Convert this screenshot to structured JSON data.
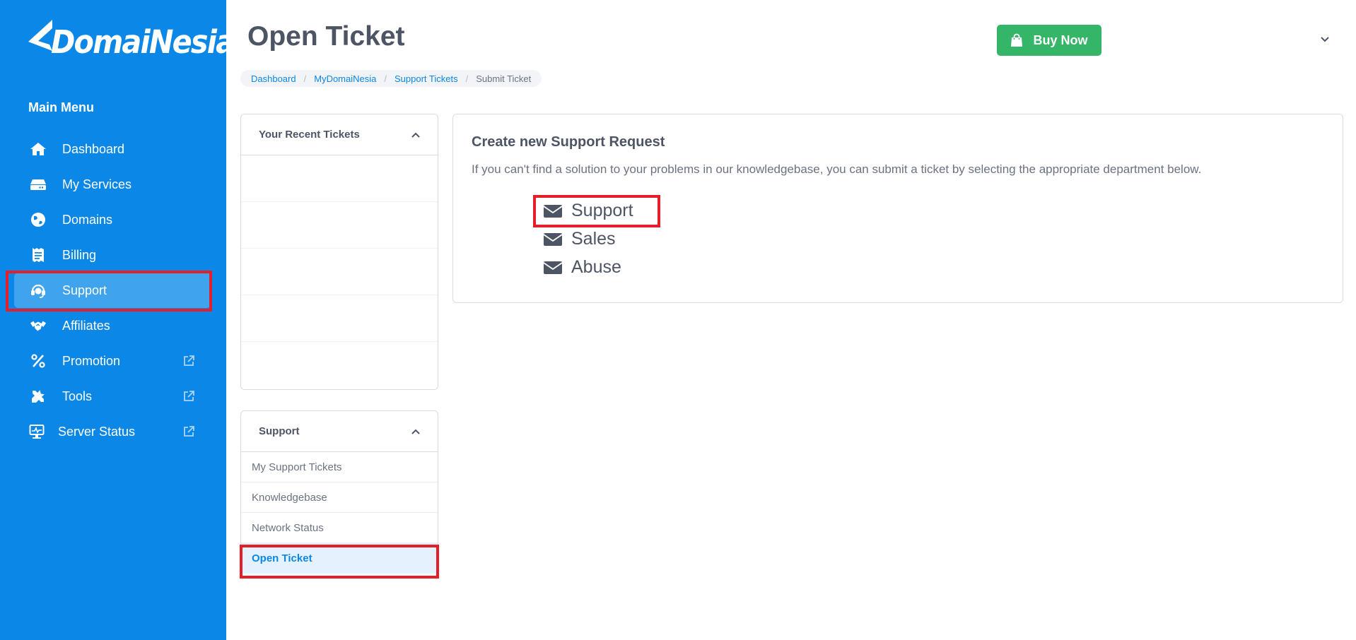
{
  "brand": {
    "name": "DomaiNesia"
  },
  "sidebar": {
    "menu_title": "Main Menu",
    "items": [
      {
        "label": "Dashboard",
        "icon": "home-icon"
      },
      {
        "label": "My Services",
        "icon": "server-icon"
      },
      {
        "label": "Domains",
        "icon": "globe-icon"
      },
      {
        "label": "Billing",
        "icon": "receipt-icon"
      },
      {
        "label": "Support",
        "icon": "headset-icon",
        "active": true
      },
      {
        "label": "Affiliates",
        "icon": "handshake-icon"
      },
      {
        "label": "Promotion",
        "icon": "percent-icon",
        "external": true
      },
      {
        "label": "Tools",
        "icon": "tools-icon",
        "external": true
      },
      {
        "label": "Server Status",
        "icon": "monitor-icon",
        "external": true
      }
    ]
  },
  "header": {
    "page_title": "Open Ticket",
    "buy_now_label": "Buy Now"
  },
  "breadcrumb": [
    "Dashboard",
    "MyDomaiNesia",
    "Support Tickets",
    "Submit Ticket"
  ],
  "recent_tickets": {
    "title": "Your Recent Tickets"
  },
  "support_panel": {
    "title": "Support",
    "links": [
      {
        "label": "My Support Tickets"
      },
      {
        "label": "Knowledgebase"
      },
      {
        "label": "Network Status"
      },
      {
        "label": "Open Ticket",
        "active": true
      }
    ]
  },
  "create_request": {
    "title": "Create new Support Request",
    "description": "If you can't find a solution to your problems in our knowledgebase, you can submit a ticket by selecting the appropriate department below.",
    "departments": [
      {
        "label": "Support",
        "icon": "envelope-icon"
      },
      {
        "label": "Sales",
        "icon": "envelope-icon"
      },
      {
        "label": "Abuse",
        "icon": "envelope-icon"
      }
    ]
  },
  "colors": {
    "sidebar": "#0b87e8",
    "active_item": "#3fa3ee",
    "buy_button": "#35b567",
    "highlight": "#e3202a",
    "link": "#0b87e8"
  }
}
